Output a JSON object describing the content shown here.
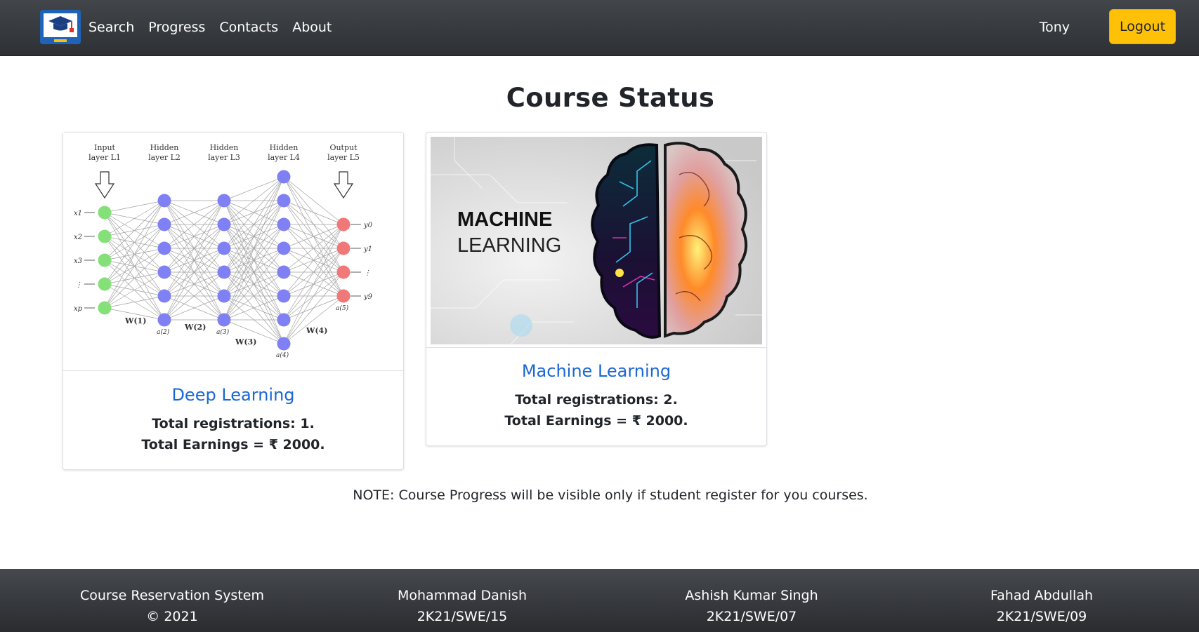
{
  "nav": {
    "links": [
      "Search",
      "Progress",
      "Contacts",
      "About"
    ],
    "user": "Tony",
    "logout_label": "Logout"
  },
  "page": {
    "title": "Course Status",
    "note": "NOTE: Course Progress will be visible only if student register for you courses."
  },
  "courses": [
    {
      "title": "Deep Learning",
      "registrations": "Total registrations: 1.",
      "earnings": "Total Earnings = ₹ 2000.",
      "image": {
        "layer_titles": [
          "Input",
          "Hidden",
          "Hidden",
          "Hidden",
          "Output"
        ],
        "layer_subtitles": [
          "layer L1",
          "layer L2",
          "layer L3",
          "layer L4",
          "layer L5"
        ],
        "input_labels": [
          "x1",
          "x2",
          "x3",
          "⋮",
          "xp"
        ],
        "output_labels": [
          "y0",
          "y1",
          "⋮",
          "y9"
        ],
        "weight_labels": [
          "W(1)",
          "W(2)",
          "W(3)",
          "W(4)"
        ],
        "activation_labels": [
          "a(2)",
          "a(3)",
          "a(4)",
          "a(5)"
        ]
      }
    },
    {
      "title": "Machine Learning",
      "registrations": "Total registrations: 2.",
      "earnings": "Total Earnings = ₹ 2000.",
      "image": {
        "line1": "MACHINE",
        "line2": "LEARNING"
      }
    }
  ],
  "footer": [
    {
      "line1": "Course Reservation System",
      "line2": "© 2021"
    },
    {
      "line1": "Mohammad Danish",
      "line2": "2K21/SWE/15"
    },
    {
      "line1": "Ashish Kumar Singh",
      "line2": "2K21/SWE/07"
    },
    {
      "line1": "Fahad Abdullah",
      "line2": "2K21/SWE/09"
    }
  ],
  "colors": {
    "accent": "#ffc107",
    "link": "#1a66d6",
    "navbar": "#343a40"
  }
}
